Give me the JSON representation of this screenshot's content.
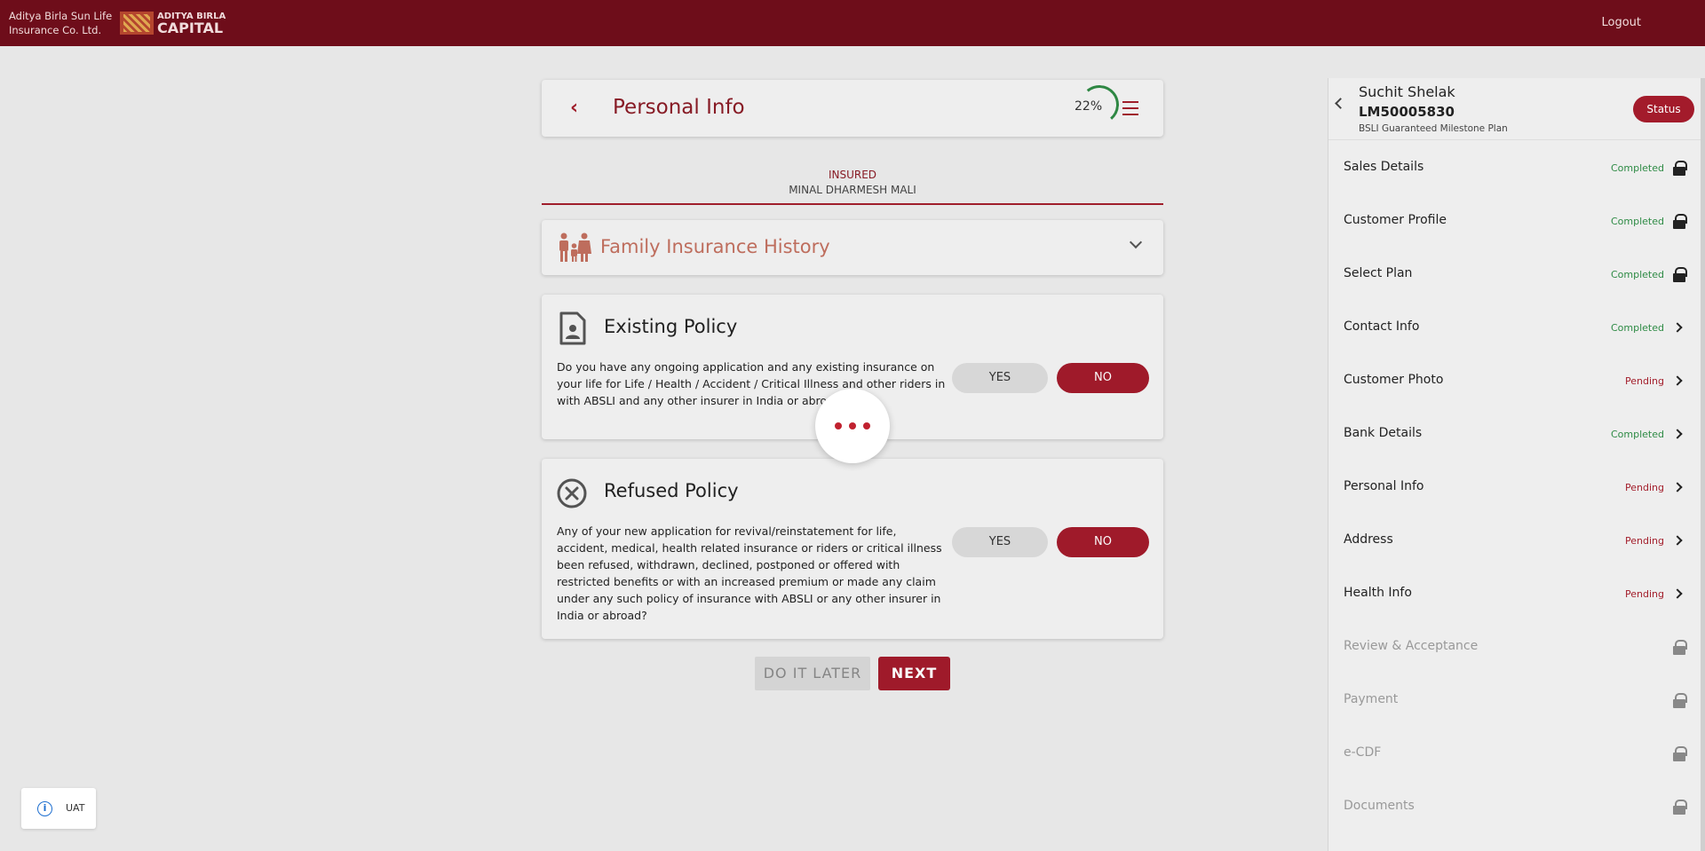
{
  "header": {
    "brand_line1": "Aditya Birla Sun Life",
    "brand_line2": "Insurance Co. Ltd.",
    "logo_line1": "ADITYA BIRLA",
    "logo_line2": "CAPITAL",
    "logout_label": "Logout"
  },
  "page": {
    "title": "Personal Info",
    "progress_label": "22%",
    "progress_fraction": 0.22
  },
  "insured": {
    "label": "INSURED",
    "name": "MINAL DHARMESH MALI"
  },
  "family_section": {
    "title": "Family Insurance History"
  },
  "existing_policy": {
    "title": "Existing Policy",
    "question": "Do you have any ongoing application and any existing insurance on your life for Life / Health / Accident / Critical Illness and other riders in with ABSLI and any other insurer in India or abroad?",
    "yes_label": "YES",
    "no_label": "NO",
    "selected": "NO"
  },
  "refused_policy": {
    "title": "Refused Policy",
    "question": "Any of your new application for revival/reinstatement for life, accident, medical, health related insurance or riders or critical illness been refused, withdrawn, declined, postponed or offered with restricted benefits or with an increased premium or made any claim under any such policy of insurance with ABSLI or any other insurer in India or abroad?",
    "yes_label": "YES",
    "no_label": "NO",
    "selected": "NO"
  },
  "actions": {
    "later_label": "DO IT LATER",
    "next_label": "NEXT"
  },
  "sidebar": {
    "customer_name": "Suchit Shelak",
    "lead_id": "LM50005830",
    "plan_name": "BSLI Guaranteed Milestone Plan",
    "status_button": "Status",
    "items": [
      {
        "label": "Sales Details",
        "status": "Completed",
        "icon": "lock-icon"
      },
      {
        "label": "Customer Profile",
        "status": "Completed",
        "icon": "lock-icon"
      },
      {
        "label": "Select Plan",
        "status": "Completed",
        "icon": "lock-icon"
      },
      {
        "label": "Contact Info",
        "status": "Completed",
        "icon": "chevron-right-icon"
      },
      {
        "label": "Customer Photo",
        "status": "Pending",
        "icon": "chevron-right-icon"
      },
      {
        "label": "Bank Details",
        "status": "Completed",
        "icon": "chevron-right-icon"
      },
      {
        "label": "Personal Info",
        "status": "Pending",
        "icon": "chevron-right-icon"
      },
      {
        "label": "Address",
        "status": "Pending",
        "icon": "chevron-right-icon"
      },
      {
        "label": "Health Info",
        "status": "Pending",
        "icon": "chevron-right-icon"
      },
      {
        "label": "Review & Acceptance",
        "status": "",
        "icon": "lock-icon"
      },
      {
        "label": "Payment",
        "status": "",
        "icon": "lock-icon"
      },
      {
        "label": "e-CDF",
        "status": "",
        "icon": "lock-icon"
      },
      {
        "label": "Documents",
        "status": "",
        "icon": "lock-icon"
      }
    ]
  },
  "env_badge": {
    "label": "UAT"
  },
  "colors": {
    "header_bg": "#6e0d1a",
    "accent": "#a31b2b",
    "completed": "#2e8b45",
    "pending": "#a31f2c"
  }
}
